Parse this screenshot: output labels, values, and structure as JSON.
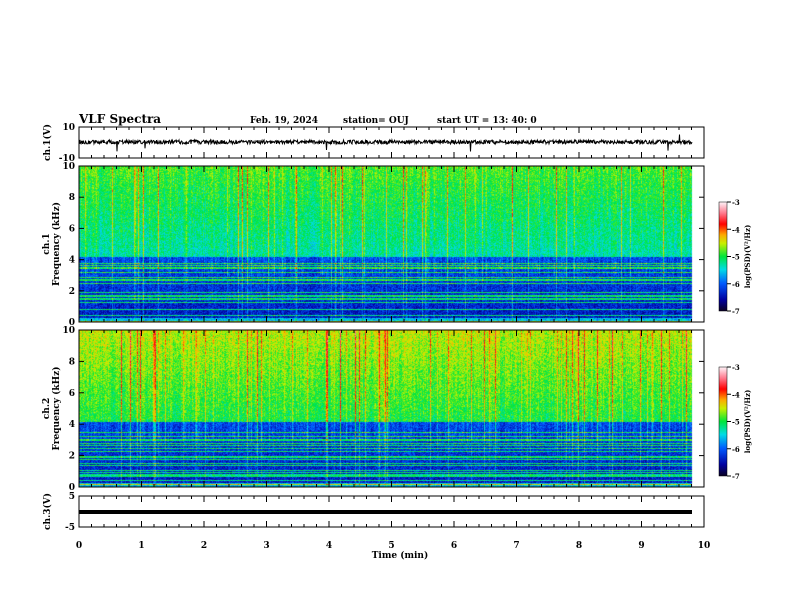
{
  "header": {
    "title": "VLF Spectra",
    "date": "Feb. 19, 2024",
    "station": "station= OUJ",
    "start": "start  UT =   13: 40: 0"
  },
  "chart_data": [
    {
      "type": "line",
      "ylabel": "ch.1(V)",
      "ylim": [
        -10,
        10
      ],
      "yticks": [
        "10",
        "-10"
      ],
      "note_values": "noise around ~0 V with occasional downward spikes"
    },
    {
      "type": "heatmap",
      "ylabel_top": "ch.1",
      "ylabel": "Frequency (kHz)",
      "ylim": [
        0,
        10
      ],
      "yticks": [
        "0",
        "2",
        "4",
        "6",
        "8",
        "10"
      ],
      "colorbar": {
        "label": "log(PSD)(V²/Hz)",
        "range": [
          -7,
          -3
        ],
        "ticks": [
          "-3",
          "-4",
          "-5",
          "-6",
          "-7"
        ]
      }
    },
    {
      "type": "heatmap",
      "ylabel_top": "ch.2",
      "ylabel": "Frequency (kHz)",
      "ylim": [
        0,
        10
      ],
      "yticks": [
        "0",
        "2",
        "4",
        "6",
        "8",
        "10"
      ],
      "colorbar": {
        "label": "log(PSD)(V²/Hz)",
        "range": [
          -7,
          -3
        ],
        "ticks": [
          "-3",
          "-4",
          "-5",
          "-6",
          "-7"
        ]
      }
    },
    {
      "type": "line",
      "ylabel": "ch.3(V)",
      "ylim": [
        -5,
        5
      ],
      "yticks": [
        "5",
        "-5"
      ],
      "value_approx": -1
    }
  ],
  "xaxis": {
    "label": "Time (min)",
    "range": [
      0,
      10
    ],
    "ticks": [
      "0",
      "1",
      "2",
      "3",
      "4",
      "5",
      "6",
      "7",
      "8",
      "9",
      "10"
    ]
  },
  "colors": {
    "trace": "#000000"
  }
}
